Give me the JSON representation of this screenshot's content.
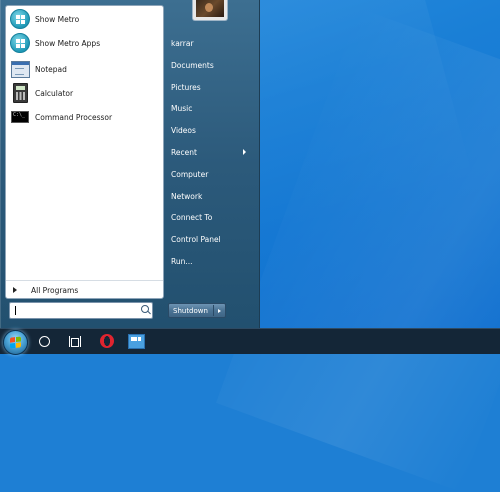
{
  "start_menu": {
    "pinned": [
      {
        "label": "Show Metro",
        "icon": "metro-icon"
      },
      {
        "label": "Show Metro Apps",
        "icon": "metro-apps-icon"
      },
      {
        "label": "Notepad",
        "icon": "notepad-icon"
      },
      {
        "label": "Calculator",
        "icon": "calculator-icon"
      },
      {
        "label": "Command Processor",
        "icon": "command-prompt-icon"
      }
    ],
    "all_programs": "All Programs",
    "search": {
      "value": "",
      "placeholder": ""
    },
    "right_items": [
      {
        "label": "karrar"
      },
      {
        "label": "Documents"
      },
      {
        "label": "Pictures"
      },
      {
        "label": "Music"
      },
      {
        "label": "Videos"
      },
      {
        "label": "Recent",
        "has_submenu": true
      },
      {
        "label": "Computer"
      },
      {
        "label": "Network"
      },
      {
        "label": "Connect To"
      },
      {
        "label": "Control Panel"
      },
      {
        "label": "Run..."
      }
    ],
    "shutdown_label": "Shutdown"
  },
  "taskbar": {
    "items": [
      "start-orb",
      "cortana-icon",
      "task-view-icon",
      "opera-icon",
      "explorer-icon"
    ]
  },
  "colors": {
    "desktop": "#1a7fd6",
    "taskbar": "#142637",
    "menu_right": "#2c5a7b"
  }
}
